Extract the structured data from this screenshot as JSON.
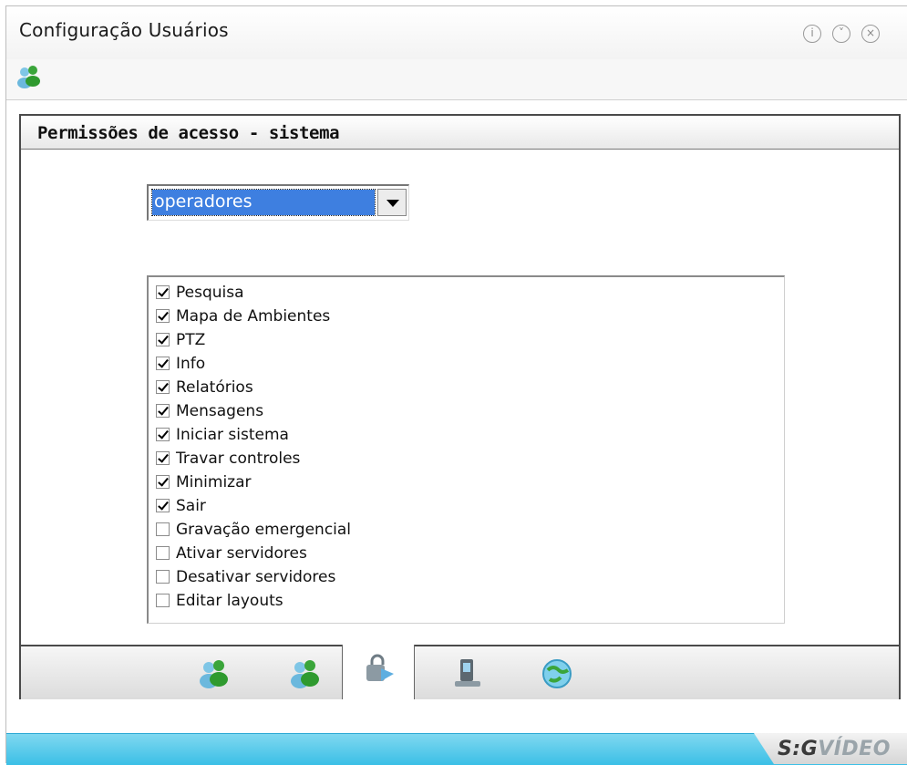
{
  "window": {
    "title": "Configuração Usuários",
    "controls": [
      "help",
      "minimize",
      "close"
    ]
  },
  "toolbar": {
    "icon": "users-icon"
  },
  "panel": {
    "title": "Permissões de acesso - sistema",
    "group_select": {
      "value": "operadores"
    },
    "permissions": [
      {
        "label": "Pesquisa",
        "checked": true
      },
      {
        "label": "Mapa de Ambientes",
        "checked": true
      },
      {
        "label": "PTZ",
        "checked": true
      },
      {
        "label": "Info",
        "checked": true
      },
      {
        "label": "Relatórios",
        "checked": true
      },
      {
        "label": "Mensagens",
        "checked": true
      },
      {
        "label": "Iniciar sistema",
        "checked": true
      },
      {
        "label": "Travar controles",
        "checked": true
      },
      {
        "label": "Minimizar",
        "checked": true
      },
      {
        "label": "Sair",
        "checked": true
      },
      {
        "label": "Gravação emergencial",
        "checked": false
      },
      {
        "label": "Ativar servidores",
        "checked": false
      },
      {
        "label": "Desativar servidores",
        "checked": false
      },
      {
        "label": "Editar layouts",
        "checked": false
      }
    ]
  },
  "tabs": [
    {
      "icon": "users-icon",
      "active": false
    },
    {
      "icon": "users-icon",
      "active": false
    },
    {
      "icon": "security-camera-icon",
      "active": true
    },
    {
      "icon": "device-icon",
      "active": false
    },
    {
      "icon": "globe-icon",
      "active": false
    }
  ],
  "footer": {
    "brand_part1": "S:G",
    "brand_part2": "VÍDEO"
  }
}
